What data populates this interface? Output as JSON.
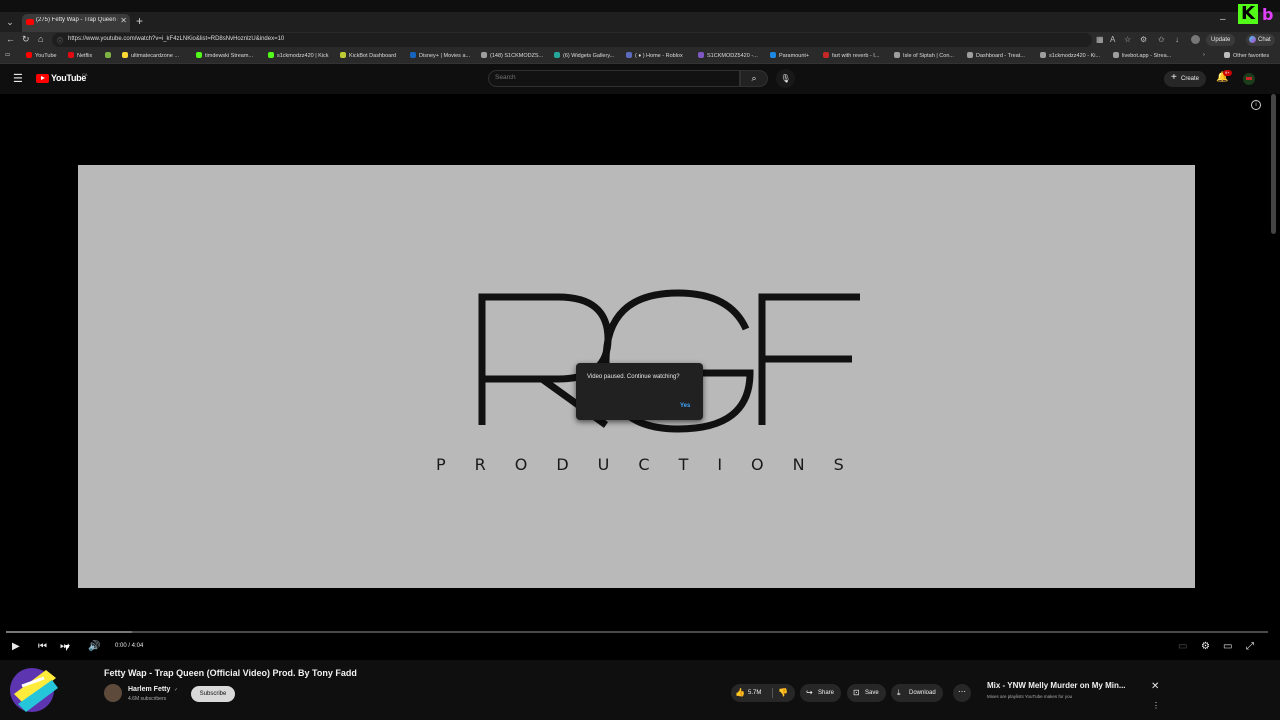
{
  "browser": {
    "active_tab_title": "(275) Fetty Wap - Trap Queen (Offi",
    "url": "https://www.youtube.com/watch?v=i_kF4zLNKio&list=RD8sNvHoznlzU&index=10",
    "update_label": "Update",
    "chat_label": "Chat",
    "bookmarks": [
      {
        "label": "YouTube",
        "color": "#ff0000"
      },
      {
        "label": "Netflix",
        "color": "#e50914"
      },
      {
        "label": "",
        "color": "#7cb342"
      },
      {
        "label": "ultimatecardzone ...",
        "color": "#fdd835"
      },
      {
        "label": "timdewski Stream...",
        "color": "#53fc18"
      },
      {
        "label": "s1ckmodzz420 | Kick",
        "color": "#53fc18"
      },
      {
        "label": "KickBot Dashboard",
        "color": "#c0ca33"
      },
      {
        "label": "Disney+ | Movies a...",
        "color": "#1565c0"
      },
      {
        "label": "(148) S1CKMODZS...",
        "color": "#9e9e9e"
      },
      {
        "label": "(6) Widgets Gallery...",
        "color": "#26a69a"
      },
      {
        "label": "( ♦ ) Home - Roblox",
        "color": "#5c6bc0"
      },
      {
        "label": "S1CKMODZ5420 -...",
        "color": "#7e57c2"
      },
      {
        "label": "Paramount+",
        "color": "#1e88e5"
      },
      {
        "label": "fart with reverb - I...",
        "color": "#c62828"
      },
      {
        "label": "Isle of Siptah | Con...",
        "color": "#9e9e9e"
      },
      {
        "label": "Dashboard - Treat...",
        "color": "#9e9e9e"
      },
      {
        "label": "s1ckmodzz420 - Ki...",
        "color": "#9e9e9e"
      },
      {
        "label": "livebot.app - Strea...",
        "color": "#9e9e9e"
      }
    ],
    "other_favorites": "Other favorites"
  },
  "yt": {
    "logo_text": "YouTube",
    "region": "CA",
    "search_placeholder": "Search",
    "create_label": "Create",
    "notif_count": "9+"
  },
  "player": {
    "video_brand_letters": "RGF",
    "video_brand_sub": "PRODUCTIONS",
    "dialog_message": "Video paused. Continue watching?",
    "dialog_yes": "Yes",
    "time": "0:00 / 4:04",
    "buffered_fraction": 0.1
  },
  "video": {
    "title": "Fetty Wap - Trap Queen (Official Video) Prod. By Tony Fadd",
    "channel": "Harlem Fetty",
    "subscribers": "4.6M subscribers",
    "subscribe_label": "Subscribe",
    "likes": "5.7M",
    "share_label": "Share",
    "save_label": "Save",
    "download_label": "Download"
  },
  "mix": {
    "title": "Mix - YNW Melly Murder on My Min...",
    "subtitle": "Mixes are playlists YouTube makes for you"
  },
  "colors": {
    "accent_red": "#ff0000",
    "link_blue": "#3ea6ff",
    "kick_green": "#53fc18"
  }
}
